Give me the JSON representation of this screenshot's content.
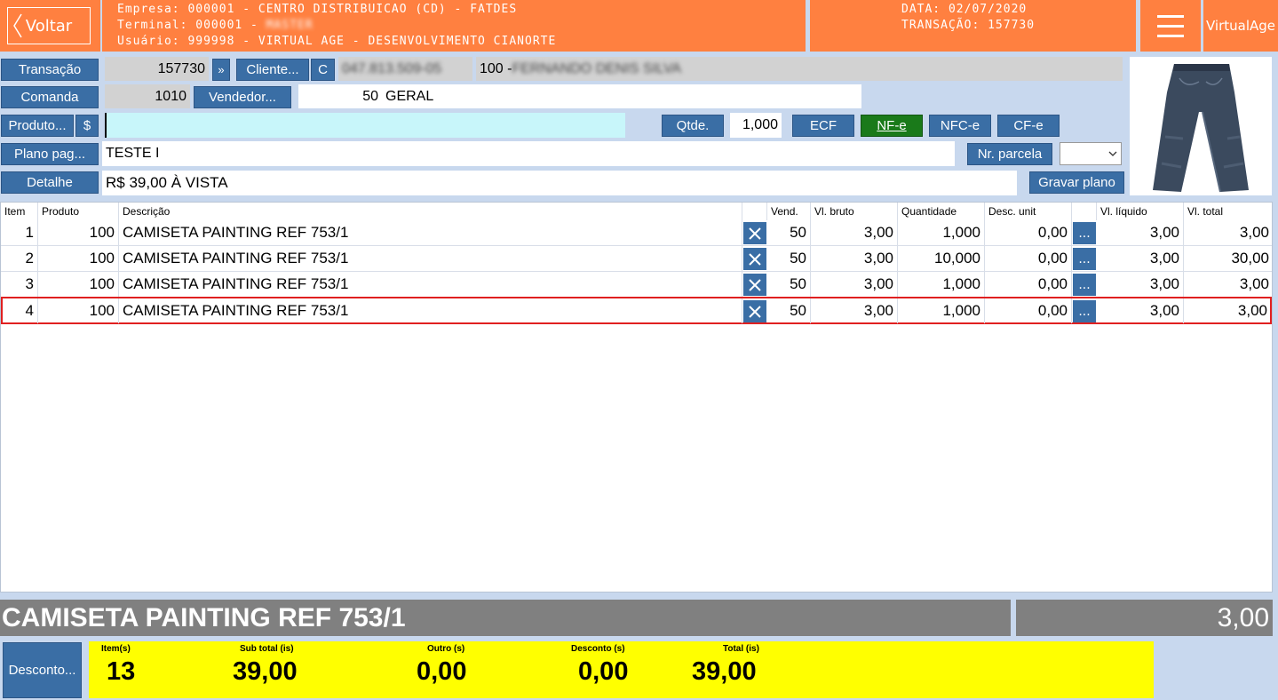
{
  "header": {
    "back_label": "Voltar",
    "empresa": "Empresa: 000001 - CENTRO DISTRIBUICAO (CD) - FATDES",
    "terminal_prefix": "Terminal: 000001 - ",
    "terminal_name": "MASTER",
    "usuario": "Usuário: 999998 - VIRTUAL AGE - DESENVOLVIMENTO CIANORTE",
    "data": "DATA: 02/07/2020",
    "transacao": "TRANSAÇÃO: 157730",
    "brand_label": "VirtualAge",
    "colors": {
      "header_bg": "#ff8040",
      "button_blue": "#3a6ea5",
      "nfe_green": "#1a7a1a",
      "totals_yellow": "#ffff00",
      "desc_gray": "#808080",
      "selected_border": "#e02020"
    }
  },
  "form": {
    "transacao_label": "Transação",
    "transacao_value": "157730",
    "arrow_label": "»",
    "cliente_label": "Cliente...",
    "c_label": "C",
    "cliente_doc": "047.813.509-05",
    "cliente_prefix": "100 - ",
    "cliente_name": "FERNANDO DENIS SILVA",
    "comanda_label": "Comanda",
    "comanda_value": "1010",
    "vendedor_label": "Vendedor...",
    "vendedor_code": "50",
    "vendedor_name": "GERAL",
    "produto_label": "Produto...",
    "dollar_label": "$",
    "produto_value": "",
    "qtde_label": "Qtde.",
    "qtde_value": "1,000",
    "ecf_label": "ECF",
    "nfe_label": "NF-e",
    "nfce_label": "NFC-e",
    "cfe_label": "CF-e",
    "plano_label": "Plano pag...",
    "plano_value": "TESTE I",
    "parcela_label": "Nr. parcela",
    "parcela_select": "",
    "detalhe_label": "Detalhe",
    "detalhe_value": "R$ 39,00 À VISTA",
    "gravar_label": "Gravar plano",
    "product_image": "jeans-pants-icon"
  },
  "table": {
    "columns": [
      "Item",
      "Produto",
      "Descrição",
      "",
      "Vend.",
      "Vl. bruto",
      "Quantidade",
      "Desc. unit",
      "",
      "Vl. líquido",
      "Vl. total"
    ],
    "rows": [
      {
        "item": "1",
        "produto": "100",
        "descricao": "CAMISETA PAINTING REF 753/1",
        "vend": "50",
        "vl_bruto": "3,00",
        "quantidade": "1,000",
        "desc_unit": "0,00",
        "dots": "...",
        "vl_liquido": "3,00",
        "vl_total": "3,00"
      },
      {
        "item": "2",
        "produto": "100",
        "descricao": "CAMISETA PAINTING REF 753/1",
        "vend": "50",
        "vl_bruto": "3,00",
        "quantidade": "10,000",
        "desc_unit": "0,00",
        "dots": "...",
        "vl_liquido": "3,00",
        "vl_total": "30,00"
      },
      {
        "item": "3",
        "produto": "100",
        "descricao": "CAMISETA PAINTING REF 753/1",
        "vend": "50",
        "vl_bruto": "3,00",
        "quantidade": "1,000",
        "desc_unit": "0,00",
        "dots": "...",
        "vl_liquido": "3,00",
        "vl_total": "3,00"
      },
      {
        "item": "4",
        "produto": "100",
        "descricao": "CAMISETA PAINTING REF 753/1",
        "vend": "50",
        "vl_bruto": "3,00",
        "quantidade": "1,000",
        "desc_unit": "0,00",
        "dots": "...",
        "vl_liquido": "3,00",
        "vl_total": "3,00"
      }
    ]
  },
  "footer": {
    "current_desc": "CAMISETA PAINTING REF 753/1",
    "current_price": "3,00",
    "desconto_label": "Desconto...",
    "itens_label": "Item(s)",
    "itens_value": "13",
    "subtotal_label": "Sub total (is)",
    "subtotal_value": "39,00",
    "outro_label": "Outro (s)",
    "outro_value": "0,00",
    "desconto_tot_label": "Desconto (s)",
    "desconto_tot_value": "0,00",
    "total_label": "Total (is)",
    "total_value": "39,00"
  }
}
